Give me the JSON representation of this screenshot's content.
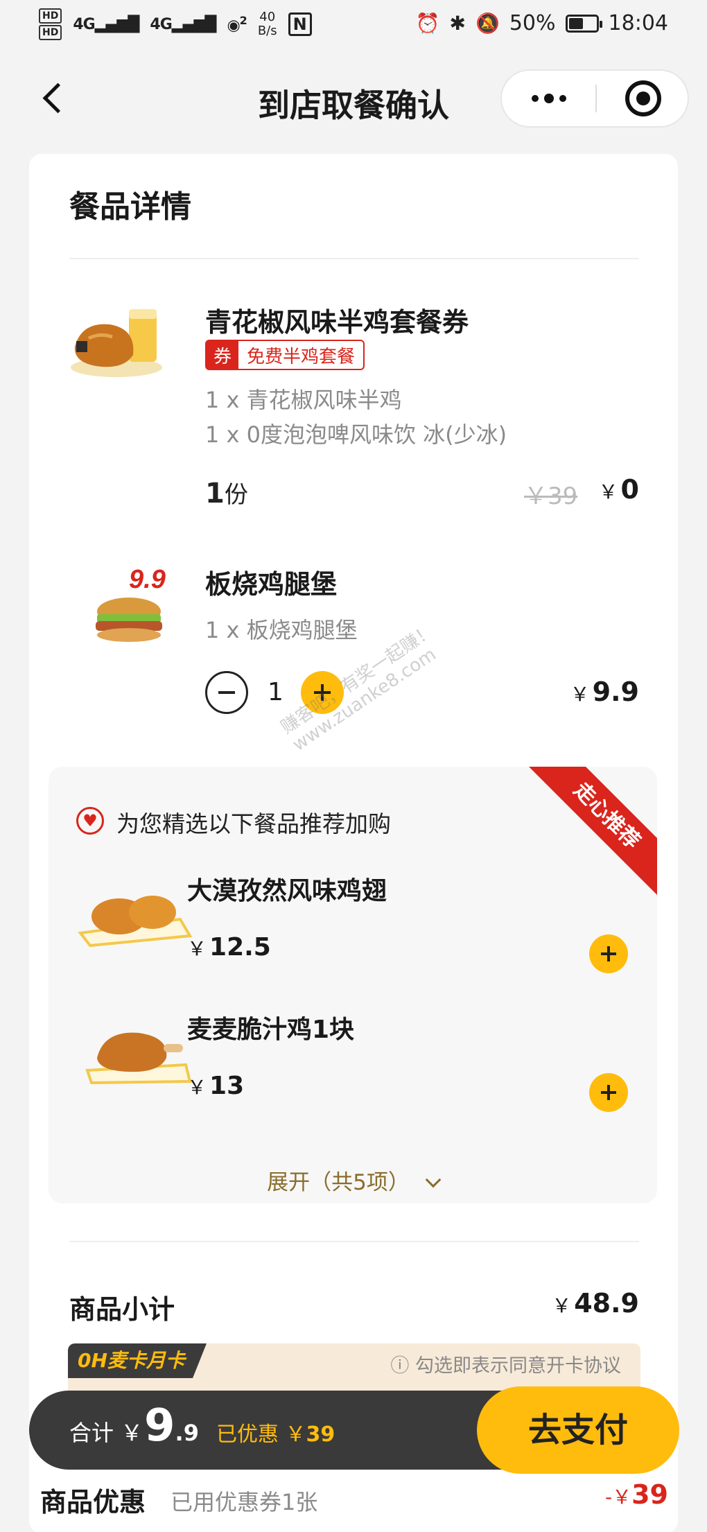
{
  "status_bar": {
    "hd1": "HD",
    "hd2": "HD",
    "signal1": "4G",
    "signal2": "4G",
    "wifi_num": "2",
    "speed_value": "40",
    "speed_unit": "B/s",
    "nfc": "N",
    "battery": "50%",
    "battery_level": 0.5,
    "time": "18:04"
  },
  "nav": {
    "title": "到店取餐确认"
  },
  "order": {
    "section_title": "餐品详情",
    "items": [
      {
        "name": "青花椒风味半鸡套餐券",
        "tag_icon": "券",
        "tag_text": "免费半鸡套餐",
        "lines": [
          "1 x 青花椒风味半鸡",
          "1 x 0度泡泡啤风味饮 冰(少冰)"
        ],
        "qty_num": "1",
        "qty_unit": "份",
        "original_price": "￥39",
        "currency": "￥",
        "price": "0"
      },
      {
        "name": "板烧鸡腿堡",
        "badge": "9.9",
        "lines": [
          "1 x 板烧鸡腿堡"
        ],
        "qty": "1",
        "currency": "￥",
        "price": "9.9"
      }
    ]
  },
  "recommend": {
    "title": "为您精选以下餐品推荐加购",
    "ribbon": "走心推荐",
    "items": [
      {
        "name": "大漠孜然风味鸡翅",
        "currency": "￥",
        "price": "12.5"
      },
      {
        "name": "麦麦脆汁鸡1块",
        "currency": "￥",
        "price": "13"
      }
    ],
    "expand_label": "展开（共5项）"
  },
  "subtotal": {
    "label": "商品小计",
    "currency": "￥",
    "value": "48.9"
  },
  "mcard": {
    "logo": "0H麦卡月卡",
    "agree_text": "ⓘ 勾选即表示同意开卡协议"
  },
  "footer": {
    "total_label": "合计 ￥",
    "total_int": "9",
    "total_dec": ".9",
    "saved_label": "已优惠 ￥",
    "saved_value": "39",
    "pay_label": "去支付"
  },
  "discount": {
    "label": "商品优惠",
    "sub": "已用优惠券1张",
    "prefix": "-￥",
    "value": "39"
  },
  "watermark": {
    "line1": "赚客吧，有奖一起赚！",
    "line2": "www.zuanke8.com"
  },
  "colors": {
    "accent_yellow": "#ffbc0d",
    "red": "#d9251c",
    "dark": "#3a3a3a"
  }
}
